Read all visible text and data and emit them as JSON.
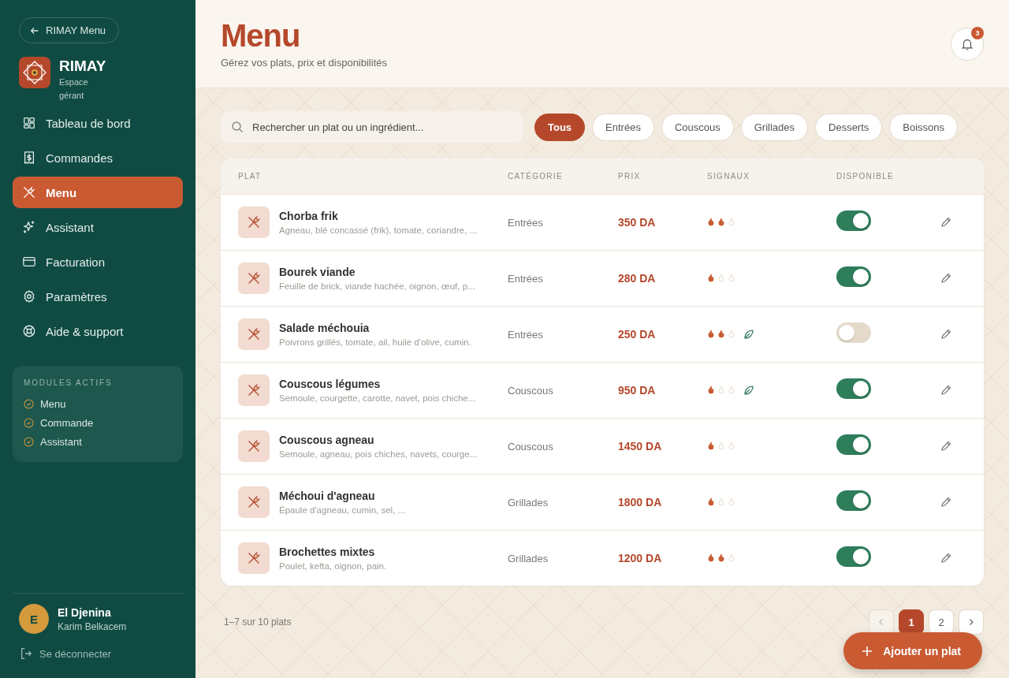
{
  "sidebar": {
    "back_button": "RIMAY Menu",
    "brand": {
      "name": "RIMAY",
      "subtitle_lines": [
        "Espace",
        "gérant"
      ]
    },
    "nav": [
      {
        "label": "Tableau de bord",
        "selected": false
      },
      {
        "label": "Commandes",
        "selected": false
      },
      {
        "label": "Menu",
        "selected": true
      },
      {
        "label": "Assistant",
        "selected": false
      },
      {
        "label": "Facturation",
        "selected": false
      },
      {
        "label": "Paramètres",
        "selected": false
      },
      {
        "label": "Aide & support",
        "selected": false
      }
    ],
    "modules": {
      "title": "MODULES ACTIFS",
      "items": [
        {
          "label": "Menu",
          "checked": true
        },
        {
          "label": "Commande",
          "checked": true
        },
        {
          "label": "Assistant",
          "checked": true
        }
      ]
    },
    "user": {
      "initial": "E",
      "name": "El Djenina",
      "subtitle": "Karim Belkacem"
    },
    "logout": "Se déconnecter"
  },
  "header": {
    "title": "Menu",
    "subtitle": "Gérez vos plats, prix et disponibilités",
    "notification_count": "3"
  },
  "search": {
    "placeholder": "Rechercher un plat ou un ingrédient..."
  },
  "filters": [
    {
      "label": "Tous",
      "selected": true
    },
    {
      "label": "Entrées",
      "selected": false
    },
    {
      "label": "Couscous",
      "selected": false
    },
    {
      "label": "Grillades",
      "selected": false
    },
    {
      "label": "Desserts",
      "selected": false
    },
    {
      "label": "Boissons",
      "selected": false
    }
  ],
  "table": {
    "columns": [
      "PLAT",
      "CATÉGORIE",
      "PRIX",
      "SIGNAUX",
      "DISPONIBLE"
    ],
    "rows": [
      {
        "name": "Chorba frik",
        "ingredients": "Agneau, blé concassé (frik), tomate, coriandre, ...",
        "category": "Entrées",
        "price": "350 DA",
        "stars": 2,
        "vegetarian": false,
        "available": true
      },
      {
        "name": "Bourek viande",
        "ingredients": "Feuille de brick, viande hachée, oignon, œuf, p...",
        "category": "Entrées",
        "price": "280 DA",
        "stars": 1,
        "vegetarian": false,
        "available": true
      },
      {
        "name": "Salade méchouia",
        "ingredients": "Poivrons grillés, tomate, ail, huile d'olive, cumin.",
        "category": "Entrées",
        "price": "250 DA",
        "stars": 2,
        "vegetarian": true,
        "available": false
      },
      {
        "name": "Couscous légumes",
        "ingredients": "Semoule, courgette, carotte, navet, pois chiche...",
        "category": "Couscous",
        "price": "950 DA",
        "stars": 1,
        "vegetarian": true,
        "available": true
      },
      {
        "name": "Couscous agneau",
        "ingredients": "Semoule, agneau, pois chiches, navets, courge...",
        "category": "Couscous",
        "price": "1450 DA",
        "stars": 1,
        "vegetarian": false,
        "available": true
      },
      {
        "name": "Méchoui d'agneau",
        "ingredients": "Épaule d'agneau, cumin, sel, ...",
        "category": "Grillades",
        "price": "1800 DA",
        "stars": 1,
        "vegetarian": false,
        "available": true
      },
      {
        "name": "Brochettes mixtes",
        "ingredients": "Poulet, kefta, oignon, pain.",
        "category": "Grillades",
        "price": "1200 DA",
        "stars": 2,
        "vegetarian": false,
        "available": true
      }
    ]
  },
  "pagination": {
    "summary": "1–7 sur 10 plats",
    "pages": [
      {
        "label": "1",
        "selected": true
      },
      {
        "label": "2",
        "selected": false
      }
    ]
  },
  "add_button": "Ajouter un plat"
}
